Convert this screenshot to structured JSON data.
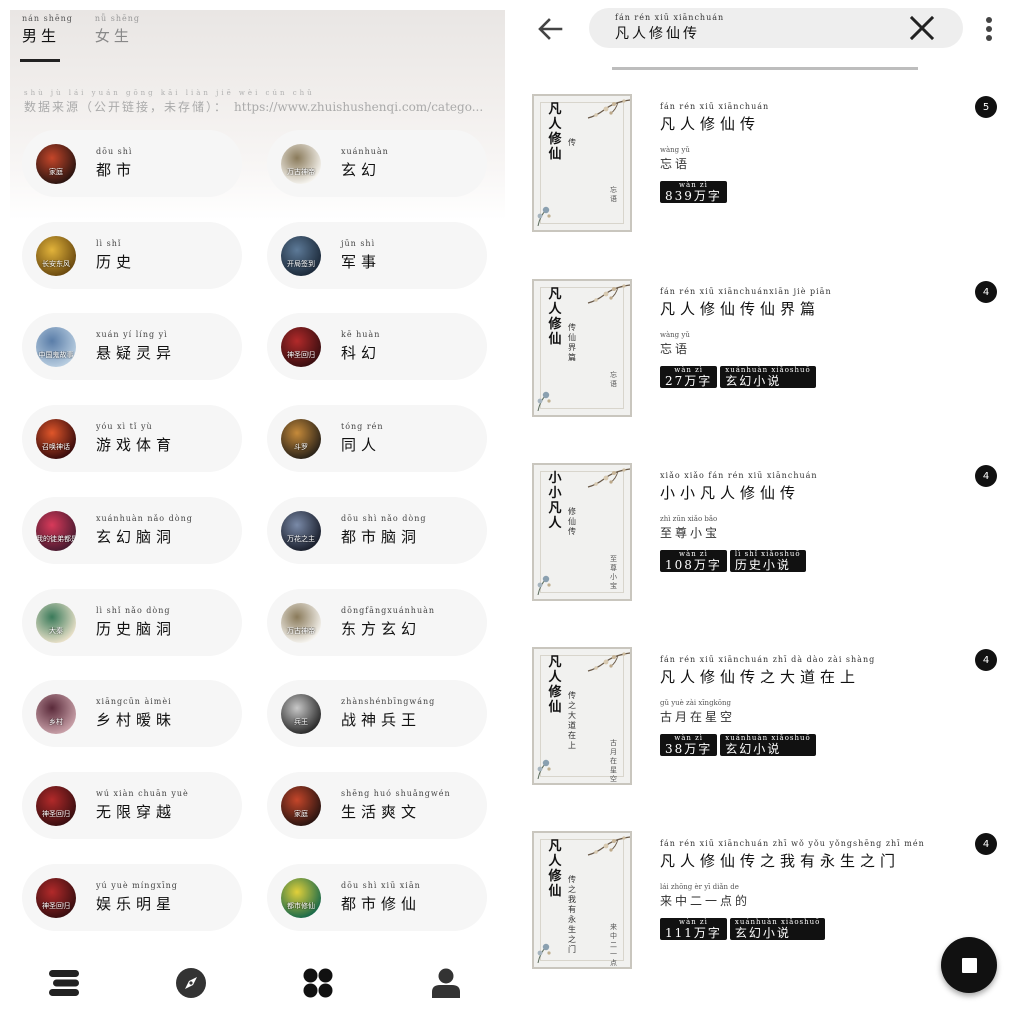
{
  "left": {
    "tabs": [
      {
        "py": "nán shēng",
        "cn": "男生",
        "active": true
      },
      {
        "py": "nǚ shēng",
        "cn": "女生",
        "active": false
      }
    ],
    "source": {
      "py": "shù jù lái yuán    gōng kāi liàn jiē    wèi cún chǔ",
      "cn": "数据来源（公开链接，未存储）：",
      "url": "https://www.zhuishushenqi.com/catego..."
    },
    "categories": [
      {
        "py": "dōu shì",
        "cn": "都市",
        "thumb": [
          "#2a1410",
          "#c4462a"
        ],
        "thumb_text": "家庭"
      },
      {
        "py": "xuánhuàn",
        "cn": "玄幻",
        "thumb": [
          "#f5f3ee",
          "#8a7a5a"
        ],
        "thumb_text": "万古神帝"
      },
      {
        "py": "lì shǐ",
        "cn": "历史",
        "thumb": [
          "#6b4a10",
          "#e2b33a"
        ],
        "thumb_text": "长安东风"
      },
      {
        "py": "jūn shì",
        "cn": "军事",
        "thumb": [
          "#1c2a3a",
          "#5d7a98"
        ],
        "thumb_text": "开局签到"
      },
      {
        "py": "xuán yí líng yì",
        "cn": "悬疑灵异",
        "thumb": [
          "#b8cde0",
          "#5a7da8"
        ],
        "thumb_text": "中国鬼故事"
      },
      {
        "py": "kē huàn",
        "cn": "科幻",
        "thumb": [
          "#3a0e10",
          "#b22a2a"
        ],
        "thumb_text": "神圣回归"
      },
      {
        "py": "yóu xì tǐ yù",
        "cn": "游戏体育",
        "thumb": [
          "#3a0c0c",
          "#e0562a"
        ],
        "thumb_text": "召唤神话"
      },
      {
        "py": "tóng rén",
        "cn": "同人",
        "thumb": [
          "#2a2218",
          "#c58a3a"
        ],
        "thumb_text": "斗罗"
      },
      {
        "py": "xuánhuàn nǎo dòng",
        "cn": "玄幻脑洞",
        "thumb": [
          "#4a1a30",
          "#d83a5a"
        ],
        "thumb_text": "我的徒弟都是大反派"
      },
      {
        "py": "dōu shì nǎo dòng",
        "cn": "都市脑洞",
        "thumb": [
          "#1a1f2c",
          "#7a8aa8"
        ],
        "thumb_text": "万花之主"
      },
      {
        "py": "lì shǐ nǎo dòng",
        "cn": "历史脑洞",
        "thumb": [
          "#e8e0c8",
          "#3a7a5a"
        ],
        "thumb_text": "大秦"
      },
      {
        "py": "dōngfāngxuánhuàn",
        "cn": "东方玄幻",
        "thumb": [
          "#f5f3ee",
          "#8a7a5a"
        ],
        "thumb_text": "万古神帝"
      },
      {
        "py": "xiāngcūn àimèi",
        "cn": "乡村暧昧",
        "thumb": [
          "#c8a0a8",
          "#5a2a3a"
        ],
        "thumb_text": "乡村"
      },
      {
        "py": "zhànshénbīngwáng",
        "cn": "战神兵王",
        "thumb": [
          "#2a2a2a",
          "#c8c8c8"
        ],
        "thumb_text": "兵王"
      },
      {
        "py": "wú xiàn chuān yuè",
        "cn": "无限穿越",
        "thumb": [
          "#3a0e10",
          "#b22a2a"
        ],
        "thumb_text": "神圣回归"
      },
      {
        "py": "shēng huó shuǎngwén",
        "cn": "生活爽文",
        "thumb": [
          "#2a1410",
          "#c4462a"
        ],
        "thumb_text": "家庭"
      },
      {
        "py": "yú yuè míngxīng",
        "cn": "娱乐明星",
        "thumb": [
          "#3a0e10",
          "#b22a2a"
        ],
        "thumb_text": "神圣回归"
      },
      {
        "py": "dōu shì xiū xiān",
        "cn": "都市修仙",
        "thumb": [
          "#1a6a4a",
          "#e2d03a"
        ],
        "thumb_text": "都市修仙"
      }
    ],
    "nav": [
      {
        "icon": "bookshelf-icon"
      },
      {
        "icon": "compass-icon"
      },
      {
        "icon": "category-grid-icon"
      },
      {
        "icon": "profile-icon"
      }
    ]
  },
  "right": {
    "search": {
      "py": "fán rén xiū xiānchuán",
      "cn": "凡人修仙传"
    },
    "books": [
      {
        "t_py": "fán rén xiū xiānchuán",
        "title": "凡人修仙传",
        "a_py": "wàng yǔ",
        "author": "忘语",
        "tags": [
          {
            "py": "wàn zì",
            "cn": "839万字"
          }
        ],
        "score": "5",
        "cover_title": "凡人修仙",
        "cover_sub": "传",
        "cover_author": "忘语"
      },
      {
        "t_py": "fán rén xiū xiānchuánxiān jiè piān",
        "title": "凡人修仙传仙界篇",
        "a_py": "wàng yǔ",
        "author": "忘语",
        "tags": [
          {
            "py": "wàn zì",
            "cn": "27万字"
          },
          {
            "py": "xuánhuàn xiǎoshuō",
            "cn": "玄幻小说"
          }
        ],
        "score": "4",
        "cover_title": "凡人修仙",
        "cover_sub": "传仙界篇",
        "cover_author": "忘语"
      },
      {
        "t_py": "xiǎo xiǎo fán rén xiū xiānchuán",
        "title": "小小凡人修仙传",
        "a_py": "zhì zūn xiǎo bǎo",
        "author": "至尊小宝",
        "tags": [
          {
            "py": "wàn zì",
            "cn": "108万字"
          },
          {
            "py": "lì shǐ xiǎoshuō",
            "cn": "历史小说"
          }
        ],
        "score": "4",
        "cover_title": "小小凡人",
        "cover_sub": "修仙传",
        "cover_author": "至尊小宝"
      },
      {
        "t_py": "fán rén xiū xiānchuán zhī dà dào zài shàng",
        "title": "凡人修仙传之大道在上",
        "a_py": "gǔ yuè zài xīngkōng",
        "author": "古月在星空",
        "tags": [
          {
            "py": "wàn zì",
            "cn": "38万字"
          },
          {
            "py": "xuánhuàn xiǎoshuō",
            "cn": "玄幻小说"
          }
        ],
        "score": "4",
        "cover_title": "凡人修仙",
        "cover_sub": "传之大道在上",
        "cover_author": "古月在星空"
      },
      {
        "t_py": "fán rén xiū xiānchuán zhī wǒ yǒu yǒngshēng zhī mén",
        "title": "凡人修仙传之我有永生之门",
        "a_py": "lái zhōng èr yī diǎn de",
        "author": "来中二一点的",
        "tags": [
          {
            "py": "wàn zì",
            "cn": "111万字"
          },
          {
            "py": "xuánhuàn xiǎoshuō",
            "cn": "玄幻小说"
          }
        ],
        "score": "4",
        "cover_title": "凡人修仙",
        "cover_sub": "传之我有永生之门",
        "cover_author": "来中二一点的"
      }
    ]
  }
}
